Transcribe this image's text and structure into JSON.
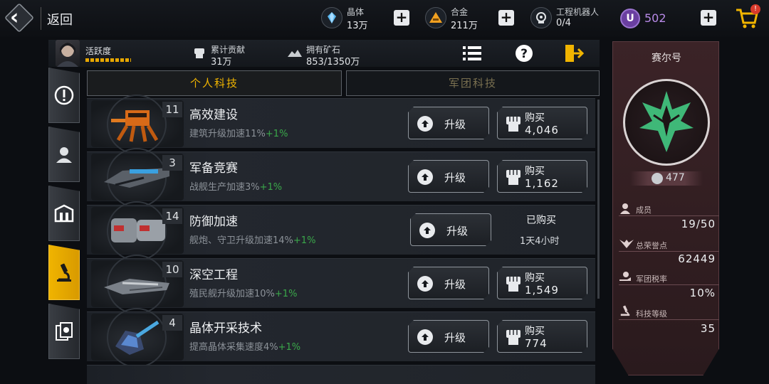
{
  "topbar": {
    "back_label": "返回",
    "resources": [
      {
        "name": "晶体",
        "value": "13万",
        "icon": "crystal-icon"
      },
      {
        "name": "合金",
        "value": "211万",
        "icon": "alloy-icon"
      },
      {
        "name": "工程机器人",
        "value": "0/4",
        "icon": "robot-icon"
      }
    ],
    "u_badge": "U",
    "u_value": "502",
    "cart_badge": "!"
  },
  "info": {
    "activity_label": "活跃度",
    "contribution_label": "累计贡献",
    "contribution_value": "31万",
    "ore_label": "拥有矿石",
    "ore_value": "853/1350万"
  },
  "tabs": {
    "personal": "个人科技",
    "legion": "军团科技"
  },
  "rows": [
    {
      "level": "11",
      "title": "高效建设",
      "desc": "建筑升级加速11%",
      "bonus": "+1%",
      "upgrade": "升级",
      "buy_label": "购买",
      "price": "4,046"
    },
    {
      "level": "3",
      "title": "军备竞赛",
      "desc": "战舰生产加速3%",
      "bonus": "+1%",
      "upgrade": "升级",
      "buy_label": "购买",
      "price": "1,162"
    },
    {
      "level": "14",
      "title": "防御加速",
      "desc": "舰炮、守卫升级加速14%",
      "bonus": "+1%",
      "upgrade": "升级",
      "bought_label": "已购买",
      "bought_time": "1天4小时"
    },
    {
      "level": "10",
      "title": "深空工程",
      "desc": "殖民舰升级加速10%",
      "bonus": "+1%",
      "upgrade": "升级",
      "buy_label": "购买",
      "price": "1,549"
    },
    {
      "level": "4",
      "title": "晶体开采技术",
      "desc": "提高晶体采集速度4%",
      "bonus": "+1%",
      "upgrade": "升级",
      "buy_label": "购买",
      "price": "774"
    }
  ],
  "panel": {
    "title": "赛尔号",
    "coins": "477",
    "members_label": "成员",
    "members_value": "19/50",
    "honor_label": "总荣誉点",
    "honor_value": "62449",
    "tax_label": "军团税率",
    "tax_value": "10%",
    "tech_label": "科技等级",
    "tech_value": "35"
  },
  "colors": {
    "accent": "#f0b400",
    "bonus_green": "#3aa84a",
    "panel_red": "#3b2327",
    "emblem_green": "#3fb878"
  }
}
